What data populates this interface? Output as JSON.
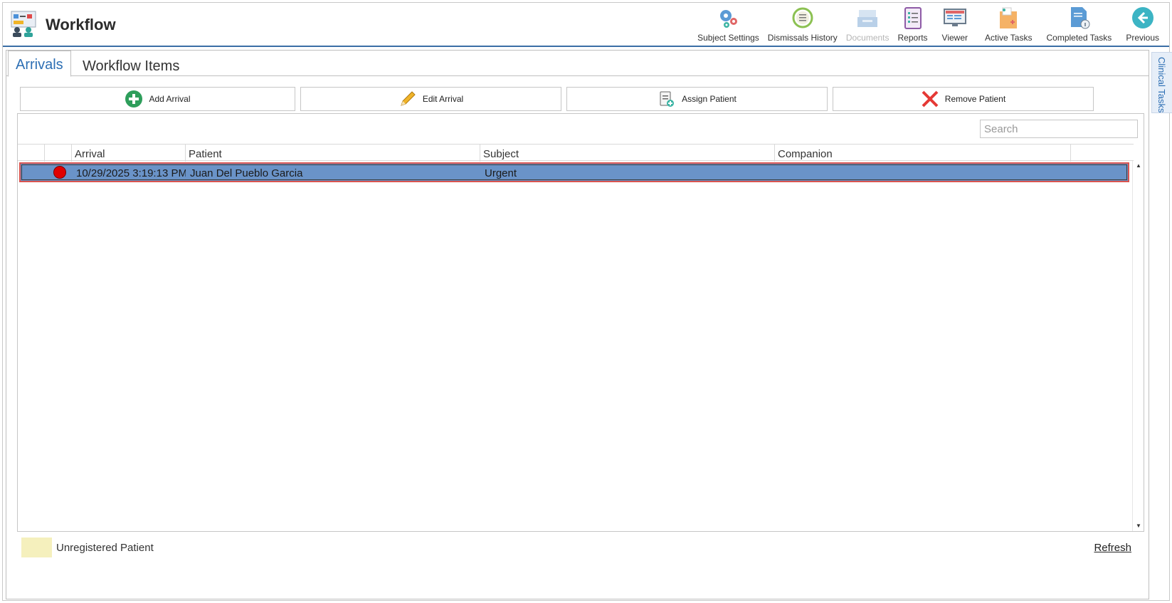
{
  "app": {
    "title": "Workflow"
  },
  "toolbar": {
    "items": [
      {
        "label": "Subject Settings",
        "icon": "gears-icon",
        "enabled": true
      },
      {
        "label": "Dismissals History",
        "icon": "history-icon",
        "enabled": true
      },
      {
        "label": "Documents",
        "icon": "inbox-tray-icon",
        "enabled": false
      },
      {
        "label": "Reports",
        "icon": "clipboard-list-icon",
        "enabled": true
      },
      {
        "label": "Viewer",
        "icon": "monitor-icon",
        "enabled": true
      },
      {
        "label": "Active Tasks",
        "icon": "task-folder-icon",
        "enabled": true
      },
      {
        "label": "Completed Tasks",
        "icon": "document-info-icon",
        "enabled": true
      },
      {
        "label": "Previous",
        "icon": "back-arrow-icon",
        "enabled": true
      }
    ]
  },
  "tabs": [
    {
      "label": "Arrivals",
      "active": true
    },
    {
      "label": "Workflow Items",
      "active": false
    }
  ],
  "actions": {
    "add": "Add Arrival",
    "edit": "Edit Arrival",
    "assign": "Assign Patient",
    "remove": "Remove Patient"
  },
  "search": {
    "placeholder": "Search",
    "value": ""
  },
  "grid": {
    "columns": [
      "Arrival",
      "Patient",
      "Subject",
      "Companion"
    ],
    "rows": [
      {
        "status_color": "#e00000",
        "arrival": "10/29/2025 3:19:13 PM",
        "patient": "Juan Del Pueblo Garcia",
        "subject": "Urgent",
        "companion": "",
        "selected": true
      }
    ]
  },
  "legend": {
    "label": "Unregistered Patient",
    "color": "#f5f0bd"
  },
  "refresh_label": "Refresh",
  "side_tab": {
    "label": "Clinical Tasks"
  },
  "colors": {
    "accent": "#2d6fb4",
    "selected_row": "#6a93c8",
    "selection_border": "#d9534f"
  }
}
